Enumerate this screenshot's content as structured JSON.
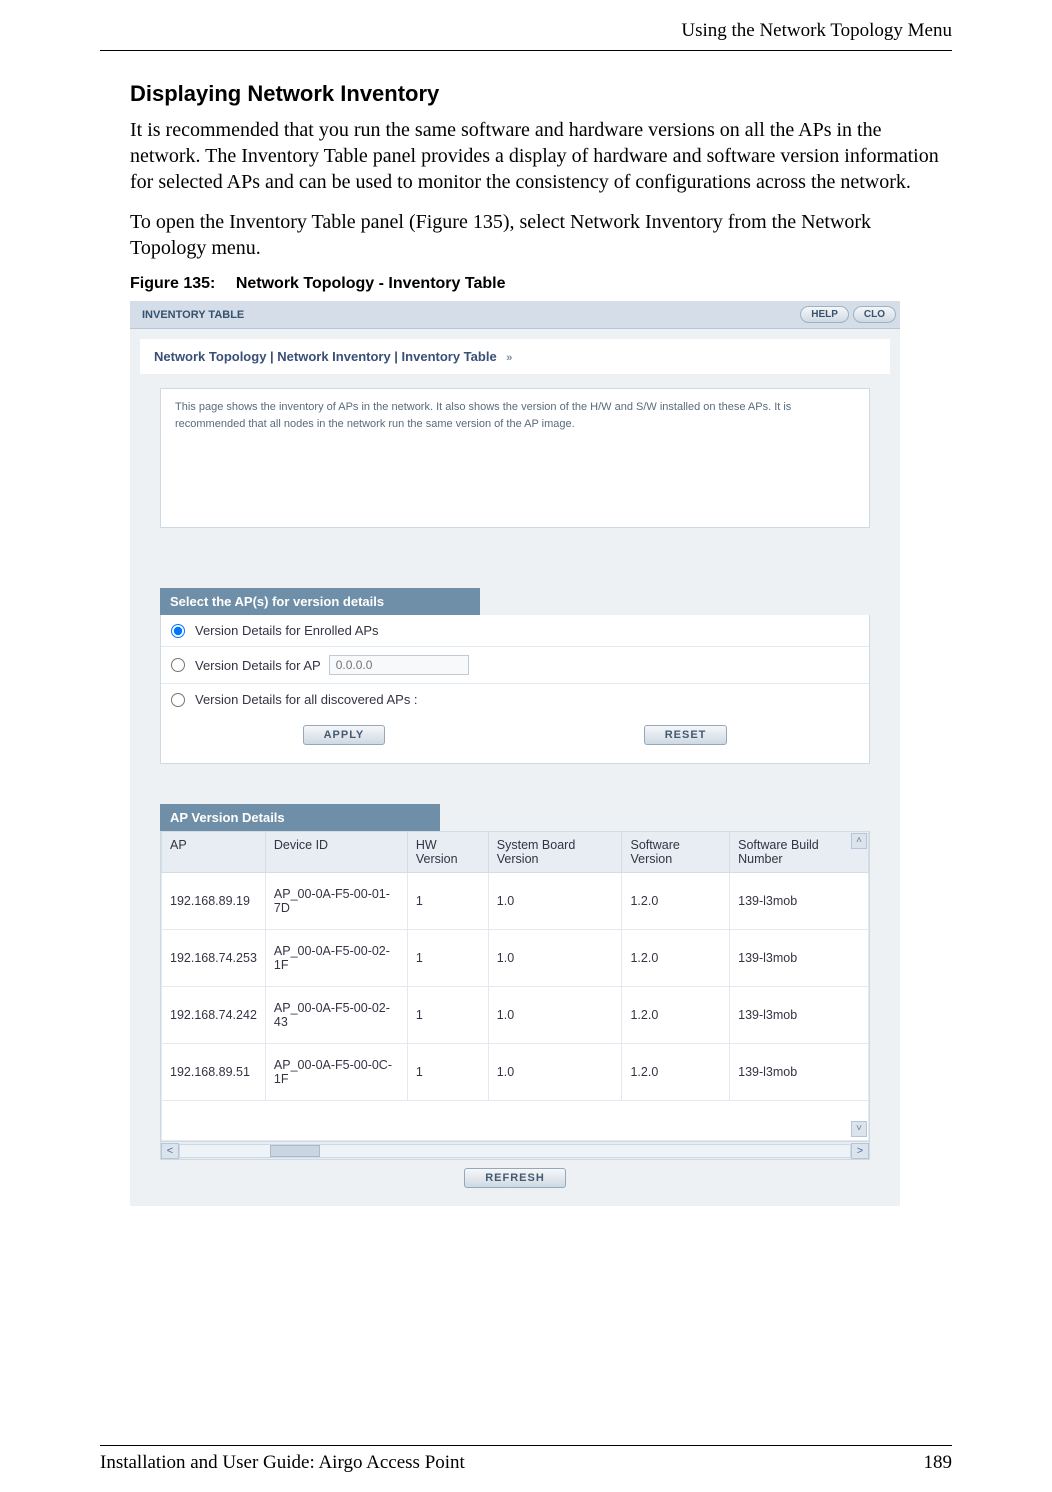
{
  "header": {
    "right": "Using the Network Topology Menu"
  },
  "section": {
    "title": "Displaying Network Inventory",
    "para1": "It is recommended that you run the same software and hardware versions on all the APs in the network. The Inventory Table panel provides a display of hardware and software version information for selected APs and can be used to monitor the consistency of configurations across the network.",
    "para2": "To open the Inventory Table panel (Figure 135), select Network Inventory from the Network Topology menu."
  },
  "figure": {
    "num": "Figure 135:",
    "title": "Network Topology - Inventory Table"
  },
  "panel": {
    "window_label": "INVENTORY TABLE",
    "help_btn": "HELP",
    "close_btn": "CLO",
    "breadcrumb": "Network Topology | Network Inventory | Inventory Table",
    "desc": "This page shows the inventory of APs in the network. It also shows the version of the H/W and S/W installed on these APs. It is recommended that all nodes in the network run the same version of the AP image.",
    "select_band": "Select the AP(s) for version details",
    "radio1": "Version Details for Enrolled APs",
    "radio2": "Version Details for AP",
    "radio2_placeholder": "0.0.0.0",
    "radio3": "Version Details for all discovered APs :",
    "apply": "APPLY",
    "reset": "RESET",
    "table_band": "AP Version Details",
    "cols": {
      "c1": "AP",
      "c2": "Device ID",
      "c3": "HW Version",
      "c4": "System Board Version",
      "c5": "Software Version",
      "c6": "Software Build Number"
    },
    "rows": [
      {
        "ap": "192.168.89.19",
        "dev": "AP_00-0A-F5-00-01-7D",
        "hw": "1",
        "sb": "1.0",
        "sw": "1.2.0",
        "bn": "139-l3mob"
      },
      {
        "ap": "192.168.74.253",
        "dev": "AP_00-0A-F5-00-02-1F",
        "hw": "1",
        "sb": "1.0",
        "sw": "1.2.0",
        "bn": "139-l3mob"
      },
      {
        "ap": "192.168.74.242",
        "dev": "AP_00-0A-F5-00-02-43",
        "hw": "1",
        "sb": "1.0",
        "sw": "1.2.0",
        "bn": "139-l3mob"
      },
      {
        "ap": "192.168.89.51",
        "dev": "AP_00-0A-F5-00-0C-1F",
        "hw": "1",
        "sb": "1.0",
        "sw": "1.2.0",
        "bn": "139-l3mob"
      }
    ],
    "refresh": "REFRESH"
  },
  "footer": {
    "left": "Installation and User Guide: Airgo Access Point",
    "right": "189"
  }
}
